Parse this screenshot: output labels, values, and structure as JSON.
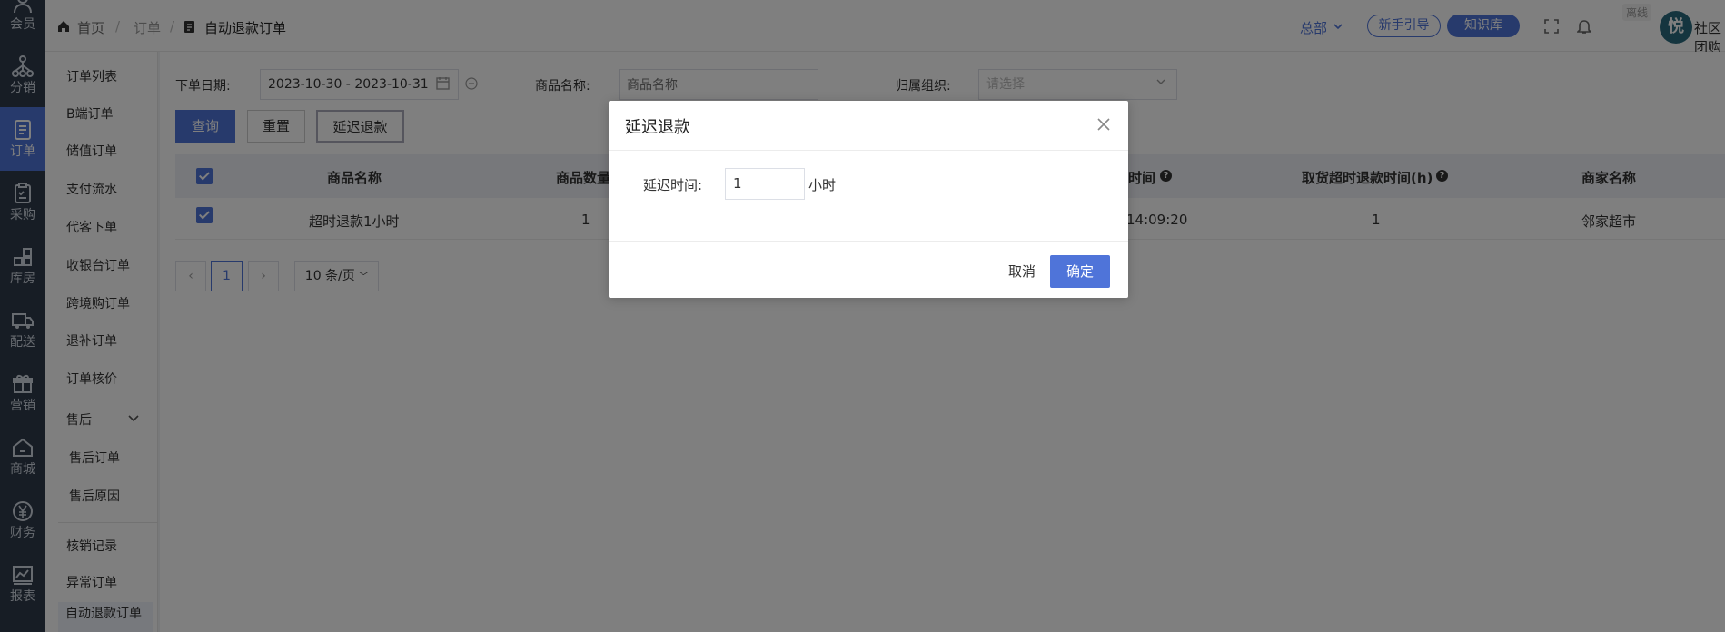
{
  "rail": [
    {
      "label": "会员",
      "icon": "user-icon"
    },
    {
      "label": "分销",
      "icon": "network-icon"
    },
    {
      "label": "订单",
      "icon": "document-icon"
    },
    {
      "label": "采购",
      "icon": "clipboard-icon"
    },
    {
      "label": "库房",
      "icon": "warehouse-icon"
    },
    {
      "label": "配送",
      "icon": "truck-icon"
    },
    {
      "label": "营销",
      "icon": "gift-icon"
    },
    {
      "label": "商城",
      "icon": "home-icon"
    },
    {
      "label": "财务",
      "icon": "yen-icon"
    },
    {
      "label": "报表",
      "icon": "chart-icon"
    }
  ],
  "submenu": {
    "items": [
      "订单列表",
      "B端订单",
      "储值订单",
      "支付流水",
      "代客下单",
      "收银台订单",
      "跨境购订单",
      "退补订单",
      "订单核价"
    ],
    "aftersale": "售后",
    "aftersale_items": [
      "售后订单",
      "售后原因"
    ],
    "more": [
      "核销记录",
      "异常订单"
    ],
    "active": "自动退款订单"
  },
  "header": {
    "breadcrumb": [
      "首页",
      "订单",
      "自动退款订单"
    ],
    "org": "总部",
    "guide": "新手引导",
    "kb": "知识库",
    "offline": "离线",
    "avatar_char": "悦",
    "user": "社区团购"
  },
  "filters": {
    "date_label": "下单日期:",
    "date_value": "2023-10-30 - 2023-10-31",
    "product_label": "商品名称:",
    "product_placeholder": "商品名称",
    "org_label": "归属组织:",
    "org_placeholder": "请选择"
  },
  "buttons": {
    "query": "查询",
    "reset": "重置",
    "delay": "延迟退款"
  },
  "table": {
    "headers": [
      "商品名称",
      "商品数量",
      "时间",
      "取货超时退款时间(h)",
      "商家名称"
    ],
    "row": {
      "name": "超时退款1小时",
      "qty": "1",
      "time": "14:09:20",
      "hours": "1",
      "merchant": "邻家超市"
    }
  },
  "pagination": {
    "page": "1",
    "size": "10 条/页"
  },
  "modal": {
    "title": "延迟退款",
    "label": "延迟时间:",
    "value": "1",
    "unit": "小时",
    "cancel": "取消",
    "ok": "确定"
  },
  "colors": {
    "primary": "#4f74d9",
    "rail": "#2f3a4b"
  }
}
